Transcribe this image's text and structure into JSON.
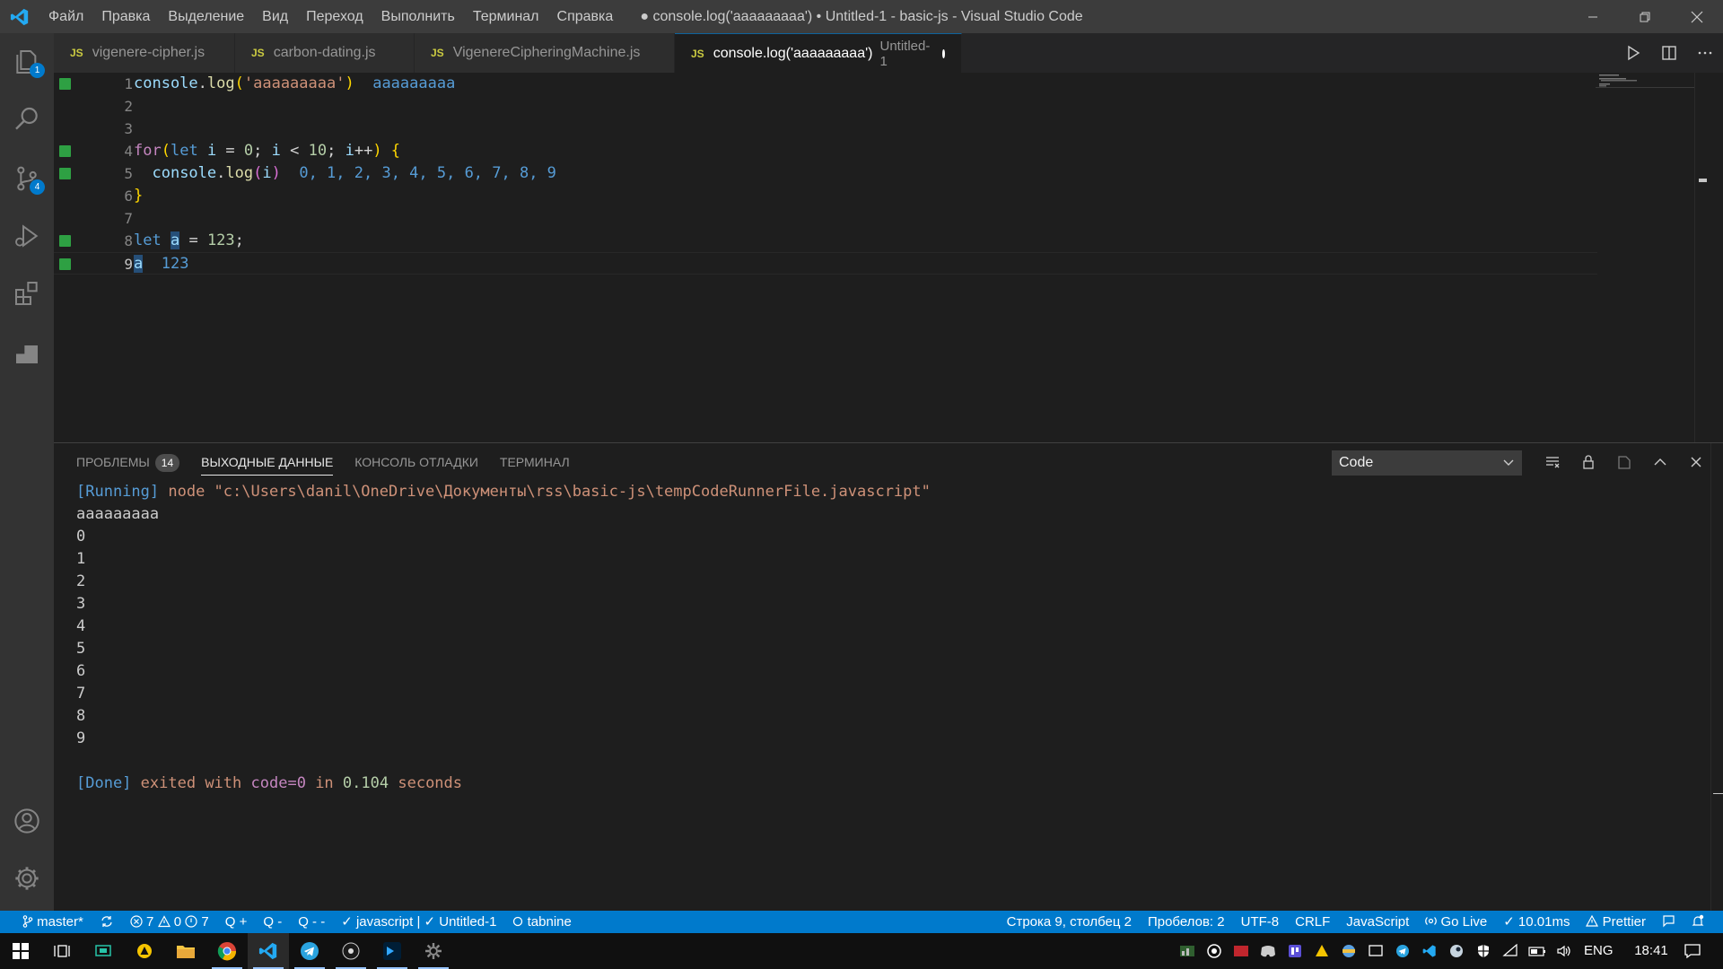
{
  "titlebar": {
    "title": "● console.log('aaaaaaaaa') • Untitled-1 - basic-js - Visual Studio Code",
    "menu": [
      "Файл",
      "Правка",
      "Выделение",
      "Вид",
      "Переход",
      "Выполнить",
      "Терминал",
      "Справка"
    ]
  },
  "activity": {
    "explorer_badge": "1",
    "scm_badge": "4"
  },
  "tabs": [
    {
      "icon": "JS",
      "label": "vigenere-cipher.js"
    },
    {
      "icon": "JS",
      "label": "carbon-dating.js"
    },
    {
      "icon": "JS",
      "label": "VigenereCipheringMachine.js"
    },
    {
      "icon": "JS",
      "label": "console.log('aaaaaaaaa')",
      "desc": "Untitled-1"
    }
  ],
  "editor": {
    "line_numbers": [
      "1",
      "2",
      "3",
      "4",
      "5",
      "6",
      "7",
      "8",
      "9"
    ],
    "l1": {
      "obj": "console",
      "dot": ".",
      "fn": "log",
      "open": "(",
      "str": "'aaaaaaaaa'",
      "close": ")",
      "result": "aaaaaaaaa"
    },
    "l4": {
      "kw": "for",
      "open": "(",
      "let": "let",
      "var1": "i",
      "eq": " = ",
      "n0": "0",
      "semi1": "; ",
      "var2": "i",
      "lt": " < ",
      "n10": "10",
      "semi2": "; ",
      "var3": "i",
      "inc": "++",
      "close": ")",
      "brace": " {"
    },
    "l5": {
      "obj": "console",
      "dot": ".",
      "fn": "log",
      "open": "(",
      "var": "i",
      "close": ")",
      "result": "0, 1, 2, 3, 4, 5, 6, 7, 8, 9"
    },
    "l6": {
      "brace": "}"
    },
    "l8": {
      "let": "let",
      "var": "a",
      "eq": " = ",
      "num": "123",
      "semi": ";"
    },
    "l9": {
      "var": "a",
      "result": "123"
    }
  },
  "panel": {
    "tabs": [
      "ПРОБЛЕМЫ",
      "ВЫХОДНЫЕ ДАННЫЕ",
      "КОНСОЛЬ ОТЛАДКИ",
      "ТЕРМИНАЛ"
    ],
    "problems_count": "14",
    "select": "Code",
    "output": {
      "running_tag": "[Running]",
      "running_cmd": "node \"c:\\Users\\danil\\OneDrive\\Документы\\rss\\basic-js\\tempCodeRunnerFile.javascript\"",
      "lines": [
        "aaaaaaaaa",
        "0",
        "1",
        "2",
        "3",
        "4",
        "5",
        "6",
        "7",
        "8",
        "9",
        ""
      ],
      "done_tag": "[Done]",
      "done_pre": "exited with",
      "done_code": "code=0",
      "done_in": "in",
      "done_time": "0.104",
      "done_unit": "seconds"
    }
  },
  "statusbar": {
    "branch": "master*",
    "errors": "7",
    "warnings": "0",
    "infos": "7",
    "q1": "Q +",
    "q2": "Q -",
    "q3": "Q - -",
    "lint": "✓ javascript | ✓ Untitled-1",
    "tabnine": "tabnine",
    "position": "Строка 9, столбец 2",
    "spaces": "Пробелов: 2",
    "encoding": "UTF-8",
    "eol": "CRLF",
    "language": "JavaScript",
    "golive": "Go Live",
    "timing": "✓ 10.01ms",
    "prettier": "Prettier"
  },
  "taskbar": {
    "lang": "ENG",
    "clock": "18:41"
  },
  "colors": {
    "accent": "#007acc",
    "titlebar": "#3c3c3c",
    "activitybar": "#333333",
    "editor_bg": "#1e1e1e",
    "modified_gutter": "#2ea043"
  }
}
